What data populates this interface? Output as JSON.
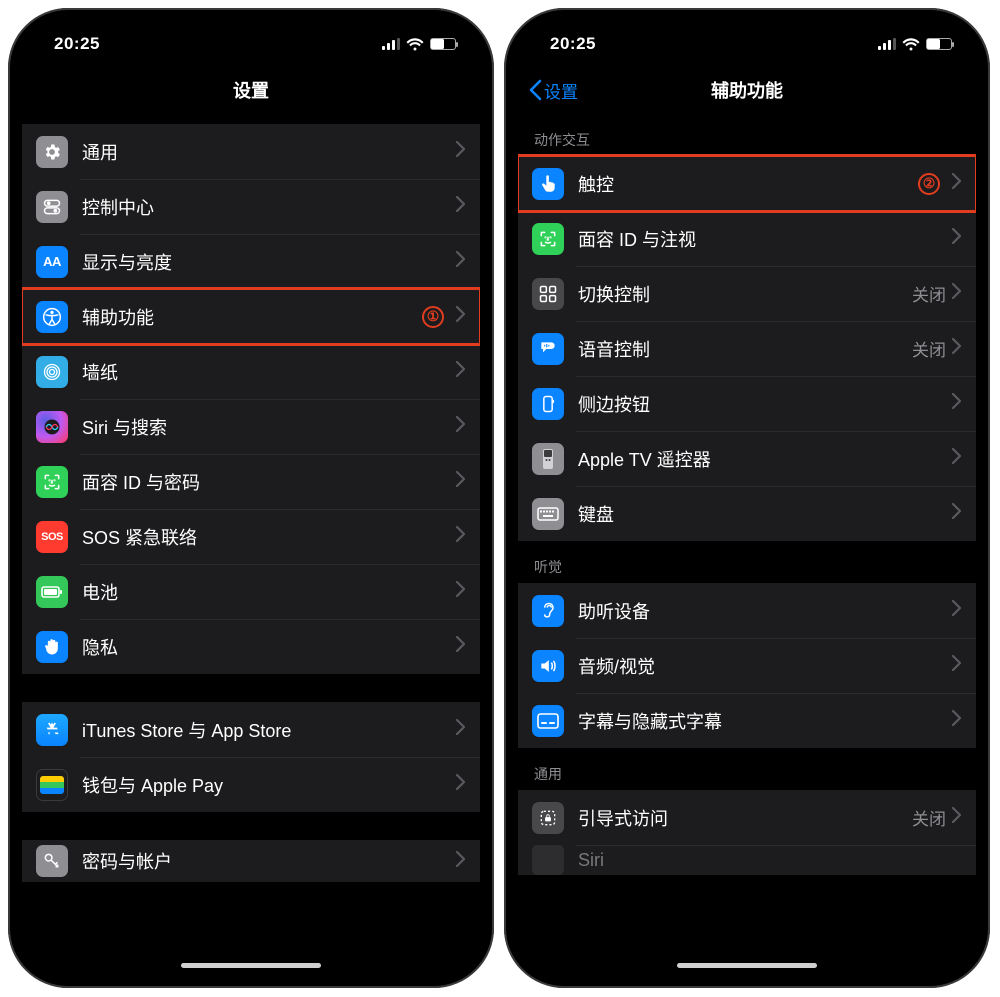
{
  "status": {
    "time": "20:25"
  },
  "left": {
    "title": "设置",
    "annotation": "①",
    "rows": {
      "general": "通用",
      "control_center": "控制中心",
      "display": "显示与亮度",
      "accessibility": "辅助功能",
      "wallpaper": "墙纸",
      "siri": "Siri 与搜索",
      "faceid": "面容 ID 与密码",
      "sos": "SOS 紧急联络",
      "battery": "电池",
      "privacy": "隐私",
      "itunes": "iTunes Store 与 App Store",
      "wallet": "钱包与 Apple Pay",
      "passwords": "密码与帐户"
    },
    "sos_label": "SOS"
  },
  "right": {
    "back": "设置",
    "title": "辅助功能",
    "annotation": "②",
    "section1": "动作交互",
    "section2": "听觉",
    "section3": "通用",
    "rows": {
      "touch": "触控",
      "faceid_attention": "面容 ID 与注视",
      "switch_control": "切换控制",
      "voice_control": "语音控制",
      "side_button": "侧边按钮",
      "apple_tv": "Apple TV 遥控器",
      "keyboard": "键盘",
      "hearing": "助听设备",
      "audio_visual": "音频/视觉",
      "subtitles": "字幕与隐藏式字幕",
      "guided_access": "引导式访问",
      "siri_partial": "Siri"
    },
    "values": {
      "switch_control": "关闭",
      "voice_control": "关闭",
      "guided_access": "关闭"
    }
  },
  "display_icon_text": "AA"
}
